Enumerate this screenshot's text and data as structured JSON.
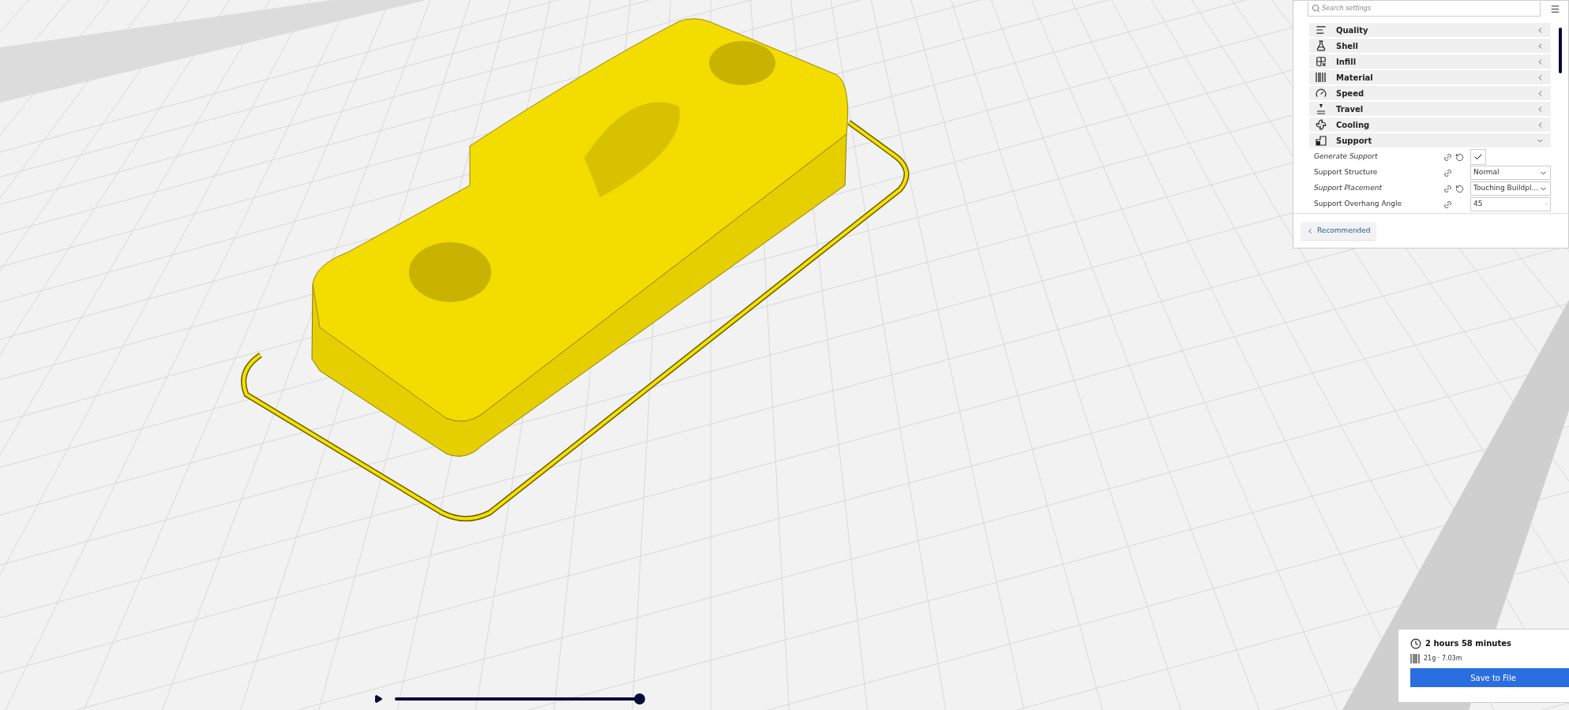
{
  "settings_panel": {
    "search": {
      "placeholder": "Search settings"
    },
    "sections": [
      {
        "label": "Quality",
        "expanded": false
      },
      {
        "label": "Shell",
        "expanded": false
      },
      {
        "label": "Infill",
        "expanded": false
      },
      {
        "label": "Material",
        "expanded": false
      },
      {
        "label": "Speed",
        "expanded": false
      },
      {
        "label": "Travel",
        "expanded": false
      },
      {
        "label": "Cooling",
        "expanded": false
      },
      {
        "label": "Support",
        "expanded": true
      }
    ],
    "settings": [
      {
        "label": "Generate Support",
        "kind": "checkbox",
        "modified": true,
        "checked": true
      },
      {
        "label": "Support Structure",
        "kind": "dropdown",
        "modified": false,
        "value": "Normal"
      },
      {
        "label": "Support Placement",
        "kind": "dropdown",
        "modified": true,
        "value": "Touching Buildpl..."
      },
      {
        "label": "Support Overhang Angle",
        "kind": "number",
        "modified": false,
        "value": "45",
        "unit": "°"
      }
    ],
    "mode_button": "Recommended"
  },
  "print_summary": {
    "time": "2 hours 58 minutes",
    "material": "21g · 7.03m",
    "save_button": "Save to File"
  },
  "layer_slider": {
    "level": 1.0
  }
}
